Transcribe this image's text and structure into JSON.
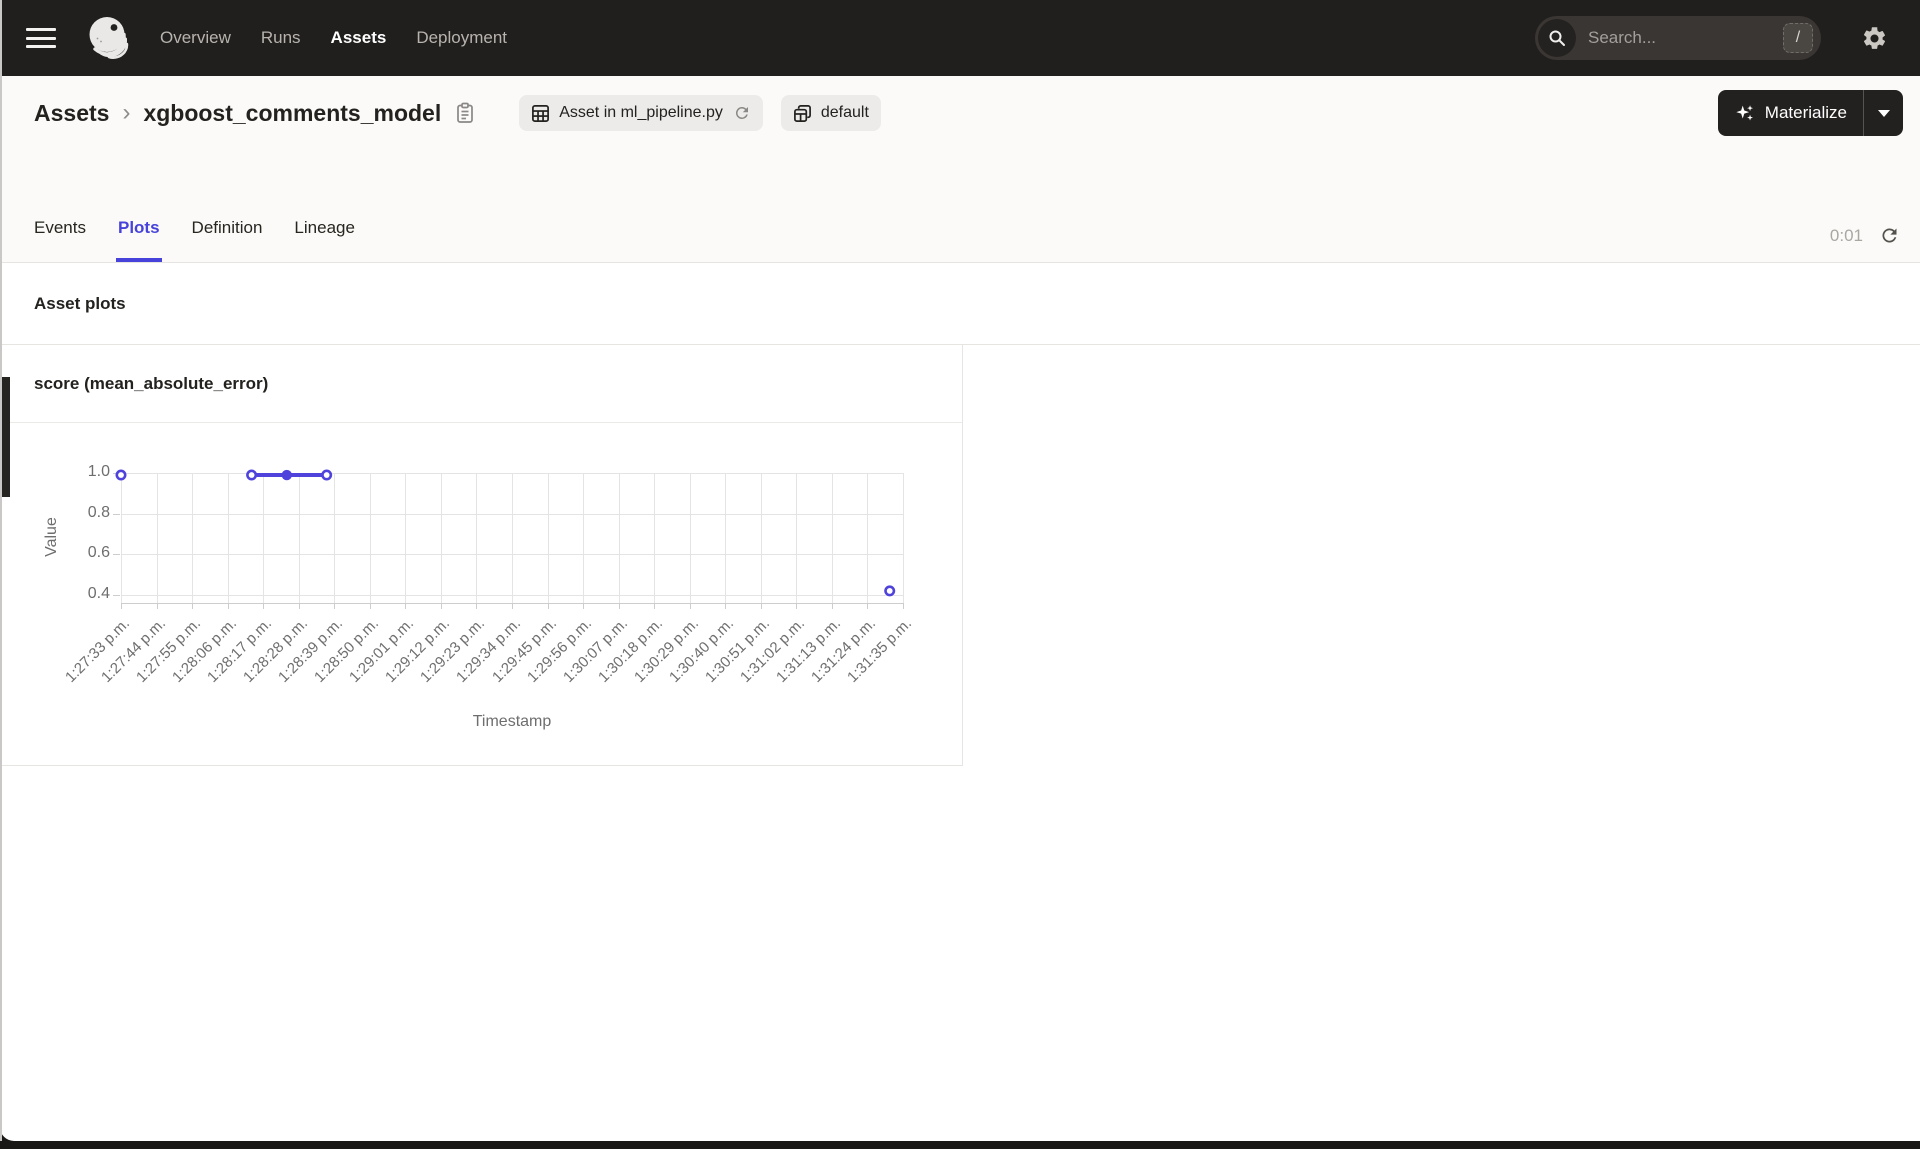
{
  "colors": {
    "accent": "#4742da",
    "header_bg": "#211f1e",
    "chart_line": "#4f43dc",
    "tag_bg": "#edebe9"
  },
  "nav": {
    "items": [
      {
        "label": "Overview",
        "active": false
      },
      {
        "label": "Runs",
        "active": false
      },
      {
        "label": "Assets",
        "active": true
      },
      {
        "label": "Deployment",
        "active": false
      }
    ],
    "search": {
      "placeholder": "Search...",
      "shortcut": "/"
    }
  },
  "breadcrumb": {
    "root": "Assets",
    "separator": "›",
    "current": "xgboost_comments_model"
  },
  "tags": [
    {
      "label": "Asset in ml_pipeline.py",
      "icon": "code-location-table",
      "has_refresh": true
    },
    {
      "label": "default",
      "icon": "asset-group",
      "has_refresh": false
    }
  ],
  "materialize": {
    "label": "Materialize"
  },
  "tabs": [
    {
      "label": "Events",
      "active": false
    },
    {
      "label": "Plots",
      "active": true
    },
    {
      "label": "Definition",
      "active": false
    },
    {
      "label": "Lineage",
      "active": false
    }
  ],
  "refresh": {
    "countdown": "0:01"
  },
  "section": {
    "title": "Asset plots"
  },
  "chart_data": {
    "type": "line",
    "title": "score (mean_absolute_error)",
    "xlabel": "Timestamp",
    "ylabel": "Value",
    "grid": true,
    "legend": false,
    "y_ticks": [
      1.0,
      0.8,
      0.6,
      0.4
    ],
    "y_tick_labels": [
      "1.0",
      "0.8",
      "0.6",
      "0.4"
    ],
    "ylim": [
      0.36,
      1.09
    ],
    "x_tick_labels": [
      "1:27:33 p.m.",
      "1:27:44 p.m.",
      "1:27:55 p.m.",
      "1:28:06 p.m.",
      "1:28:17 p.m.",
      "1:28:28 p.m.",
      "1:28:39 p.m.",
      "1:28:50 p.m.",
      "1:29:01 p.m.",
      "1:29:12 p.m.",
      "1:29:23 p.m.",
      "1:29:34 p.m.",
      "1:29:45 p.m.",
      "1:29:56 p.m.",
      "1:30:07 p.m.",
      "1:30:18 p.m.",
      "1:30:29 p.m.",
      "1:30:40 p.m.",
      "1:30:51 p.m.",
      "1:31:02 p.m.",
      "1:31:13 p.m.",
      "1:31:24 p.m.",
      "1:31:35 p.m."
    ],
    "series": [
      {
        "name": "score (mean_absolute_error)",
        "color": "#4f43dc",
        "points": [
          {
            "x_frac": 0.0,
            "y": 0.99,
            "marker": "open"
          },
          {
            "x_frac": 0.167,
            "y": 0.99,
            "marker": "open"
          },
          {
            "x_frac": 0.212,
            "y": 0.99,
            "marker": "solid"
          },
          {
            "x_frac": 0.263,
            "y": 0.99,
            "marker": "open"
          },
          {
            "x_frac": 0.983,
            "y": 0.42,
            "marker": "open"
          }
        ],
        "connected_point_indices": [
          1,
          2,
          3
        ]
      }
    ]
  }
}
